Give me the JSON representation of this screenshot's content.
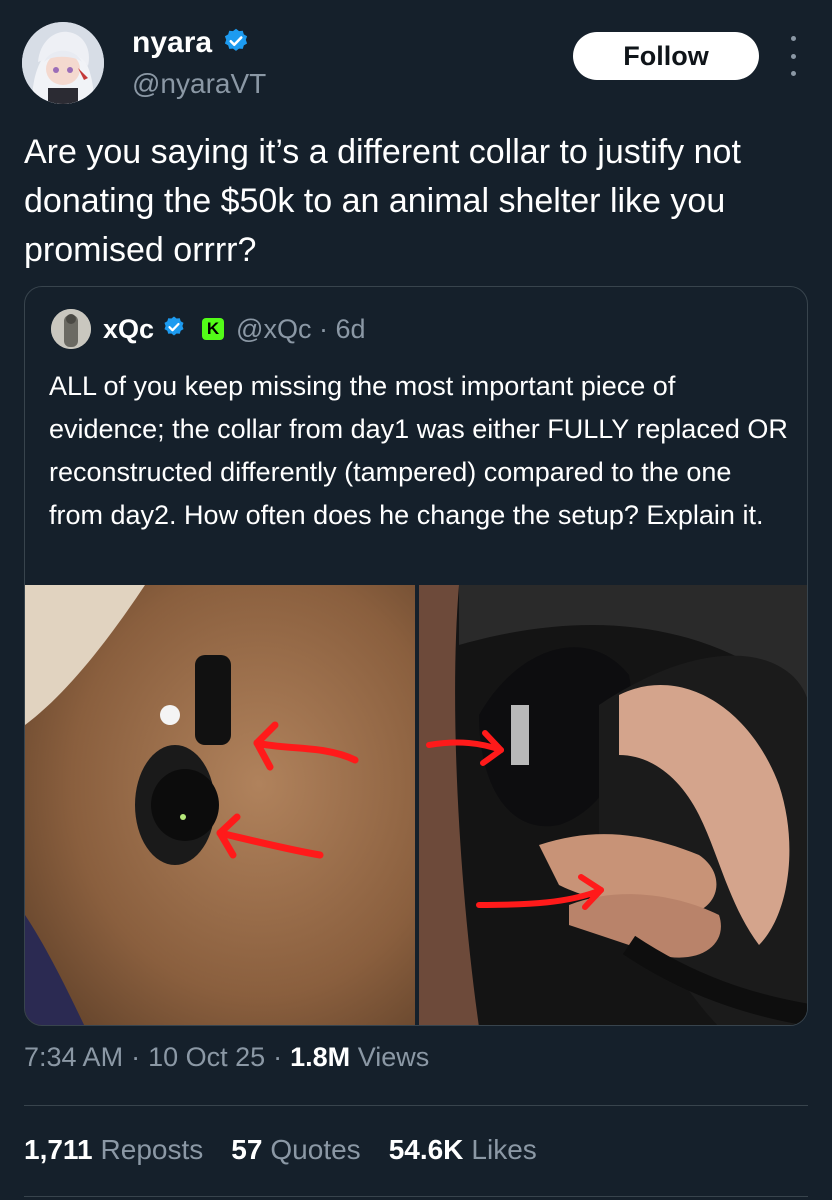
{
  "author": {
    "display_name": "nyara",
    "handle": "@nyaraVT",
    "verified_color": "#1d9bf0"
  },
  "actions": {
    "follow_label": "Follow",
    "more_icon": "more-vertical-icon"
  },
  "tweet": {
    "text": "Are you saying it’s a different collar to justify not donating the $50k to an animal shelter like you promised orrrr?"
  },
  "quoted": {
    "display_name": "xQc",
    "handle_time": "@xQc · 6d",
    "badge_letter": "K",
    "badge_color": "#53fc18",
    "text": "ALL of you keep missing the most important piece of evidence; the collar from day1 was either FULLY replaced OR reconstructed differently (tampered) compared to the one from day2. How often does he change the setup? Explain it.",
    "images": [
      "collar-photo-day1",
      "collar-photo-day2"
    ]
  },
  "meta": {
    "time": "7:34 AM",
    "sep1": "·",
    "date": "10 Oct 25",
    "sep2": "·",
    "views_count": "1.8M",
    "views_label": "Views"
  },
  "stats": {
    "reposts_count": "1,711",
    "reposts_label": "Reposts",
    "quotes_count": "57",
    "quotes_label": "Quotes",
    "likes_count": "54.6K",
    "likes_label": "Likes"
  }
}
